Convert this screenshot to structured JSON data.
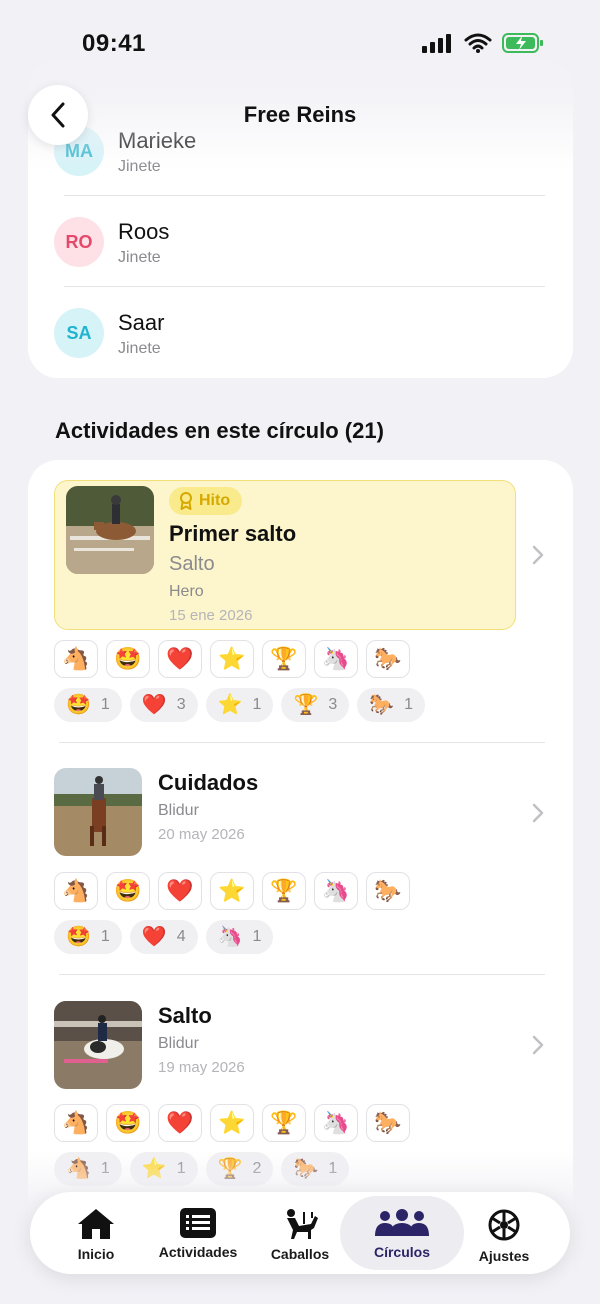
{
  "status_bar": {
    "time": "09:41"
  },
  "header": {
    "title": "Free Reins"
  },
  "members": [
    {
      "initials": "MA",
      "name": "Marieke",
      "role": "Jinete",
      "bg": "#d6f3f8",
      "fg": "#3bbad0"
    },
    {
      "initials": "RO",
      "name": "Roos",
      "role": "Jinete",
      "bg": "#fde1e6",
      "fg": "#e5486a"
    },
    {
      "initials": "SA",
      "name": "Saar",
      "role": "Jinete",
      "bg": "#d6f3f8",
      "fg": "#1fb4cf"
    }
  ],
  "activities_section": {
    "title": "Actividades en este círculo (21)"
  },
  "emoji_palette": [
    "🐴",
    "🤩",
    "❤️",
    "⭐",
    "🏆",
    "🦄",
    "🐎"
  ],
  "activities": [
    {
      "badge": "Hito",
      "title": "Primer salto",
      "subtitle": "Salto",
      "horse": "Hero",
      "date": "15 ene 2026",
      "reactions": [
        {
          "emoji": "🤩",
          "count": "1"
        },
        {
          "emoji": "❤️",
          "count": "3"
        },
        {
          "emoji": "⭐",
          "count": "1"
        },
        {
          "emoji": "🏆",
          "count": "3"
        },
        {
          "emoji": "🐎",
          "count": "1"
        }
      ]
    },
    {
      "title": "Cuidados",
      "horse": "Blidur",
      "date": "20 may 2026",
      "reactions": [
        {
          "emoji": "🤩",
          "count": "1"
        },
        {
          "emoji": "❤️",
          "count": "4"
        },
        {
          "emoji": "🦄",
          "count": "1"
        }
      ]
    },
    {
      "title": "Salto",
      "horse": "Blidur",
      "date": "19 may 2026",
      "reactions": [
        {
          "emoji": "🐴",
          "count": "1"
        },
        {
          "emoji": "⭐",
          "count": "1"
        },
        {
          "emoji": "🏆",
          "count": "2"
        },
        {
          "emoji": "🐎",
          "count": "1"
        }
      ]
    }
  ],
  "tab_bar": {
    "tabs": [
      {
        "label": "Inicio",
        "icon": "home-icon"
      },
      {
        "label": "Actividades",
        "icon": "list-icon"
      },
      {
        "label": "Caballos",
        "icon": "horse-rider-icon"
      },
      {
        "label": "Círculos",
        "icon": "people-group-icon",
        "active": true
      },
      {
        "label": "Ajustes",
        "icon": "settings-wheel-icon"
      }
    ]
  },
  "colors": {
    "background": "#f1f1f6",
    "milestone_bg": "#fdf6cc",
    "milestone_border": "#f2df7a",
    "accent_active_tab": "#2b2466"
  }
}
